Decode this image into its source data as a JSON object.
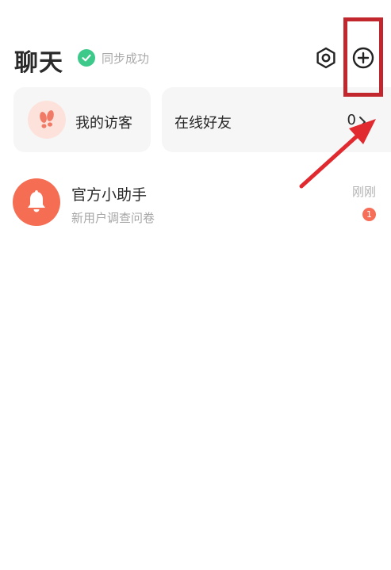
{
  "header": {
    "title": "聊天",
    "sync_status": "同步成功"
  },
  "cards": {
    "visitors_label": "我的访客",
    "friends_label": "在线好友",
    "friends_count": "0"
  },
  "chats": [
    {
      "name": "官方小助手",
      "preview": "新用户调查问卷",
      "time": "刚刚",
      "unread": "1"
    }
  ],
  "icons": {
    "settings": "settings-hexagon-icon",
    "add": "plus-circle-icon",
    "visitors": "footprints-icon",
    "assistant": "bell-icon"
  },
  "colors": {
    "sync_green": "#3cc98a",
    "accent_red": "#f56e54",
    "annotation_red": "#c1272d"
  }
}
